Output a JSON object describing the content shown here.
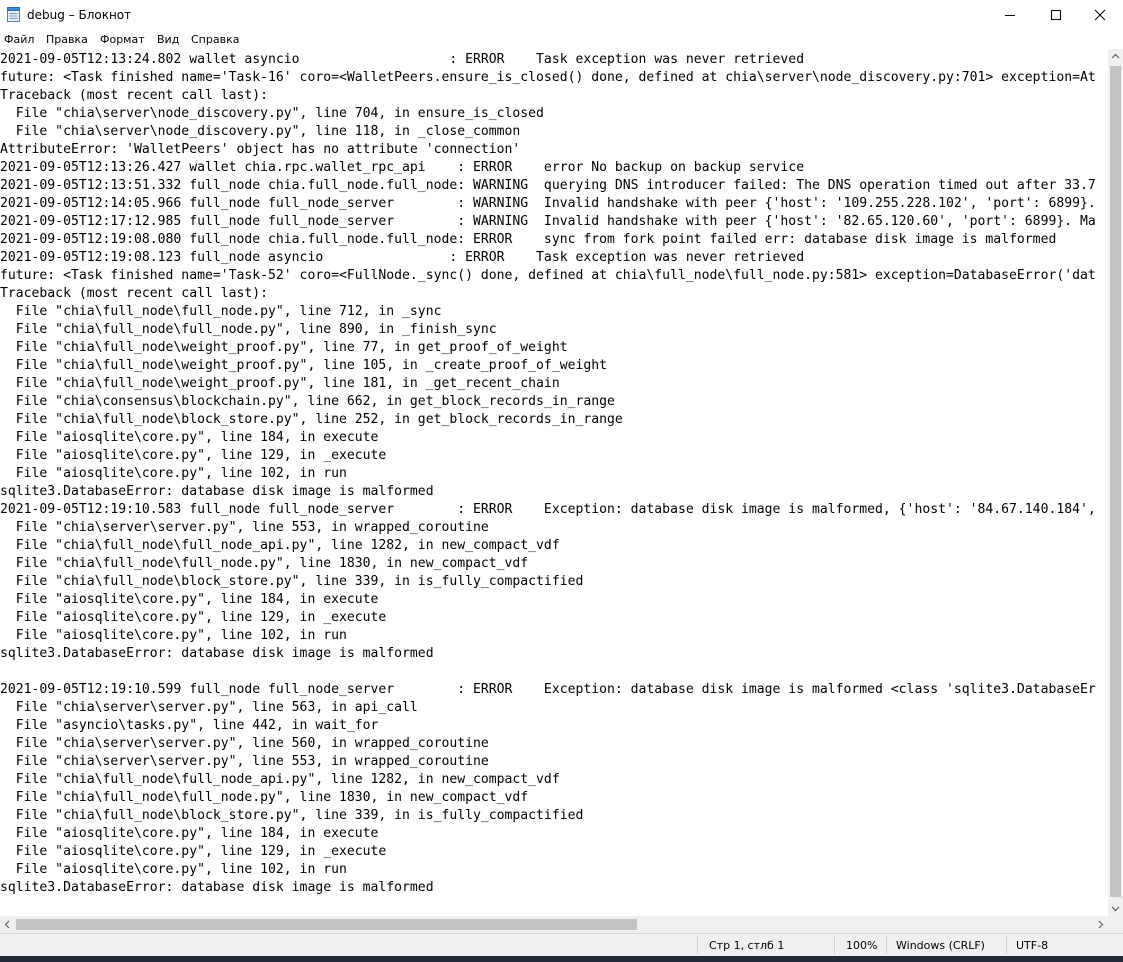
{
  "window": {
    "title": "debug – Блокнот"
  },
  "icons": {
    "app": "notepad-icon",
    "minimize": "minimize-icon",
    "maximize": "maximize-icon",
    "close": "close-icon"
  },
  "menu": {
    "items": [
      {
        "label": "Файл"
      },
      {
        "label": "Правка"
      },
      {
        "label": "Формат"
      },
      {
        "label": "Вид"
      },
      {
        "label": "Справка"
      }
    ]
  },
  "editor": {
    "lines": [
      "2021-09-05T12:13:24.802 wallet asyncio                   : ERROR    Task exception was never retrieved",
      "future: <Task finished name='Task-16' coro=<WalletPeers.ensure_is_closed() done, defined at chia\\server\\node_discovery.py:701> exception=At",
      "Traceback (most recent call last):",
      "  File \"chia\\server\\node_discovery.py\", line 704, in ensure_is_closed",
      "  File \"chia\\server\\node_discovery.py\", line 118, in _close_common",
      "AttributeError: 'WalletPeers' object has no attribute 'connection'",
      "2021-09-05T12:13:26.427 wallet chia.rpc.wallet_rpc_api    : ERROR    error No backup on backup service",
      "2021-09-05T12:13:51.332 full_node chia.full_node.full_node: WARNING  querying DNS introducer failed: The DNS operation timed out after 33.7",
      "2021-09-05T12:14:05.966 full_node full_node_server        : WARNING  Invalid handshake with peer {'host': '109.255.228.102', 'port': 6899}.",
      "2021-09-05T12:17:12.985 full_node full_node_server        : WARNING  Invalid handshake with peer {'host': '82.65.120.60', 'port': 6899}. Ma",
      "2021-09-05T12:19:08.080 full_node chia.full_node.full_node: ERROR    sync from fork point failed err: database disk image is malformed",
      "2021-09-05T12:19:08.123 full_node asyncio                : ERROR    Task exception was never retrieved",
      "future: <Task finished name='Task-52' coro=<FullNode._sync() done, defined at chia\\full_node\\full_node.py:581> exception=DatabaseError('dat",
      "Traceback (most recent call last):",
      "  File \"chia\\full_node\\full_node.py\", line 712, in _sync",
      "  File \"chia\\full_node\\full_node.py\", line 890, in _finish_sync",
      "  File \"chia\\full_node\\weight_proof.py\", line 77, in get_proof_of_weight",
      "  File \"chia\\full_node\\weight_proof.py\", line 105, in _create_proof_of_weight",
      "  File \"chia\\full_node\\weight_proof.py\", line 181, in _get_recent_chain",
      "  File \"chia\\consensus\\blockchain.py\", line 662, in get_block_records_in_range",
      "  File \"chia\\full_node\\block_store.py\", line 252, in get_block_records_in_range",
      "  File \"aiosqlite\\core.py\", line 184, in execute",
      "  File \"aiosqlite\\core.py\", line 129, in _execute",
      "  File \"aiosqlite\\core.py\", line 102, in run",
      "sqlite3.DatabaseError: database disk image is malformed",
      "2021-09-05T12:19:10.583 full_node full_node_server        : ERROR    Exception: database disk image is malformed, {'host': '84.67.140.184',",
      "  File \"chia\\server\\server.py\", line 553, in wrapped_coroutine",
      "  File \"chia\\full_node\\full_node_api.py\", line 1282, in new_compact_vdf",
      "  File \"chia\\full_node\\full_node.py\", line 1830, in new_compact_vdf",
      "  File \"chia\\full_node\\block_store.py\", line 339, in is_fully_compactified",
      "  File \"aiosqlite\\core.py\", line 184, in execute",
      "  File \"aiosqlite\\core.py\", line 129, in _execute",
      "  File \"aiosqlite\\core.py\", line 102, in run",
      "sqlite3.DatabaseError: database disk image is malformed",
      "",
      "2021-09-05T12:19:10.599 full_node full_node_server        : ERROR    Exception: database disk image is malformed <class 'sqlite3.DatabaseEr",
      "  File \"chia\\server\\server.py\", line 563, in api_call",
      "  File \"asyncio\\tasks.py\", line 442, in wait_for",
      "  File \"chia\\server\\server.py\", line 560, in wrapped_coroutine",
      "  File \"chia\\server\\server.py\", line 553, in wrapped_coroutine",
      "  File \"chia\\full_node\\full_node_api.py\", line 1282, in new_compact_vdf",
      "  File \"chia\\full_node\\full_node.py\", line 1830, in new_compact_vdf",
      "  File \"chia\\full_node\\block_store.py\", line 339, in is_fully_compactified",
      "  File \"aiosqlite\\core.py\", line 184, in execute",
      "  File \"aiosqlite\\core.py\", line 129, in _execute",
      "  File \"aiosqlite\\core.py\", line 102, in run",
      "sqlite3.DatabaseError: database disk image is malformed"
    ]
  },
  "status": {
    "position": "Стр 1, стлб 1",
    "zoom": "100%",
    "line_ending": "Windows (CRLF)",
    "encoding": "UTF-8"
  }
}
